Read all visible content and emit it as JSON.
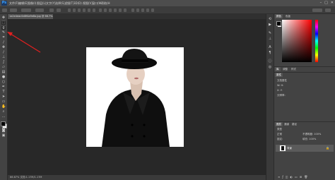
{
  "app": {
    "logo_text": "Ps"
  },
  "menu": {
    "items": [
      "文件(F)",
      "编辑(E)",
      "图像(I)",
      "图层(L)",
      "文字(Y)",
      "选择(S)",
      "滤镜(T)",
      "3D(D)",
      "视图(V)",
      "窗口(W)",
      "帮助(H)"
    ]
  },
  "window_controls": {
    "minimize": "–",
    "maximize": "□",
    "close": "✕"
  },
  "document": {
    "tab_label": "1a2e4eac0d8f4a9e8a.jpg @ 66.7%(RGB/8#)",
    "zoom": "66.67%",
    "status_text": "66.67%    文档:1.17M/1.17M"
  },
  "panels": {
    "top_tabs": [
      "颜色",
      "色板"
    ],
    "adjust_tabs": [
      "库",
      "调整",
      "样式"
    ],
    "properties_title": "属性",
    "properties_rows": [
      "文档属性",
      "W:   H:",
      "X:   Y:",
      "分辨率:"
    ],
    "layers_tabs": [
      "图层",
      "通道",
      "路径"
    ],
    "layers_filter": "类型",
    "blend_mode": "正常",
    "opacity": "不透明度: 100%",
    "lock_label": "锁定:",
    "fill": "填充: 100%",
    "layer_name": "背景",
    "layer_lock_icon": "🔒"
  },
  "colors": {
    "foreground": "#000000",
    "background": "#ffffff",
    "picker_hue": "#ff0000",
    "annotation": "#e02020",
    "canvas_bg": "#282828",
    "panel_bg": "#434343"
  },
  "icons": {
    "tools": [
      "move-icon",
      "marquee-icon",
      "lasso-icon",
      "quick-select-icon",
      "crop-icon",
      "eyedropper-icon",
      "healing-icon",
      "brush-icon",
      "clone-stamp-icon",
      "history-brush-icon",
      "eraser-icon",
      "gradient-icon",
      "blur-icon",
      "dodge-icon",
      "pen-icon",
      "type-icon",
      "path-select-icon",
      "rectangle-icon",
      "hand-icon",
      "zoom-icon"
    ],
    "panel_strip": [
      "history-icon",
      "actions-icon",
      "brush-panel-icon",
      "character-icon",
      "paragraph-icon",
      "info-icon",
      "glyphs-icon"
    ]
  }
}
